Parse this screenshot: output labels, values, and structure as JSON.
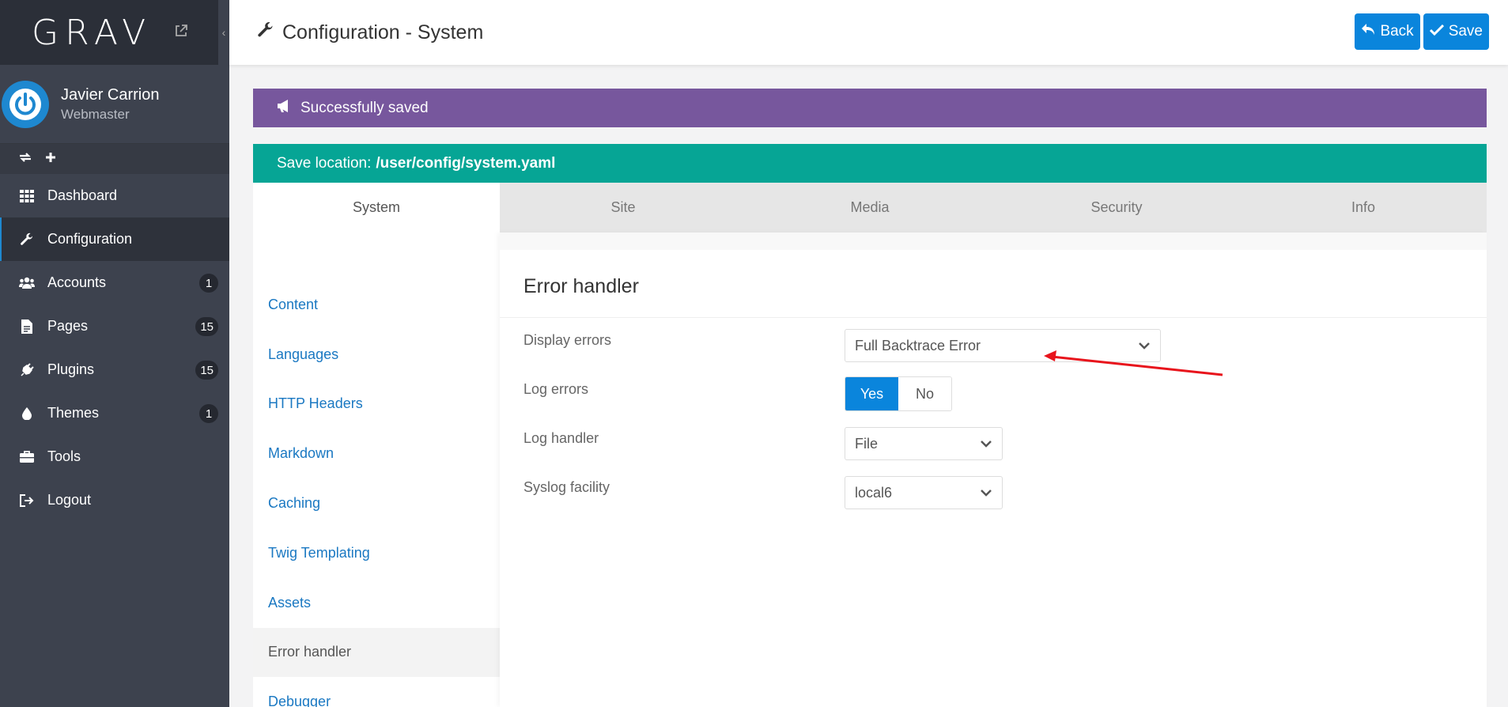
{
  "app": {
    "logo": "GRAV"
  },
  "user": {
    "name": "Javier Carrion",
    "role": "Webmaster"
  },
  "sidebar": {
    "items": [
      {
        "label": "Dashboard",
        "badge": ""
      },
      {
        "label": "Configuration",
        "badge": ""
      },
      {
        "label": "Accounts",
        "badge": "1"
      },
      {
        "label": "Pages",
        "badge": "15"
      },
      {
        "label": "Plugins",
        "badge": "15"
      },
      {
        "label": "Themes",
        "badge": "1"
      },
      {
        "label": "Tools",
        "badge": ""
      },
      {
        "label": "Logout",
        "badge": ""
      }
    ]
  },
  "header": {
    "title": "Configuration - System",
    "back_label": "Back",
    "save_label": "Save"
  },
  "alerts": {
    "success": "Successfully saved",
    "save_location_prefix": "Save location:",
    "save_location_path": "/user/config/system.yaml"
  },
  "tabs": [
    "System",
    "Site",
    "Media",
    "Security",
    "Info"
  ],
  "subnav": [
    "Content",
    "Languages",
    "HTTP Headers",
    "Markdown",
    "Caching",
    "Twig Templating",
    "Assets",
    "Error handler",
    "Debugger"
  ],
  "section": {
    "title": "Error handler",
    "display_errors": {
      "label": "Display errors",
      "value": "Full Backtrace Error"
    },
    "log_errors": {
      "label": "Log errors",
      "yes": "Yes",
      "no": "No"
    },
    "log_handler": {
      "label": "Log handler",
      "value": "File"
    },
    "syslog_facility": {
      "label": "Syslog facility",
      "value": "local6"
    }
  },
  "colors": {
    "accent": "#0a85dc",
    "purple_alert": "#77579d",
    "teal_alert": "#06a595",
    "sidebar": "#3d424e",
    "annotation_arrow": "#e8141c"
  }
}
